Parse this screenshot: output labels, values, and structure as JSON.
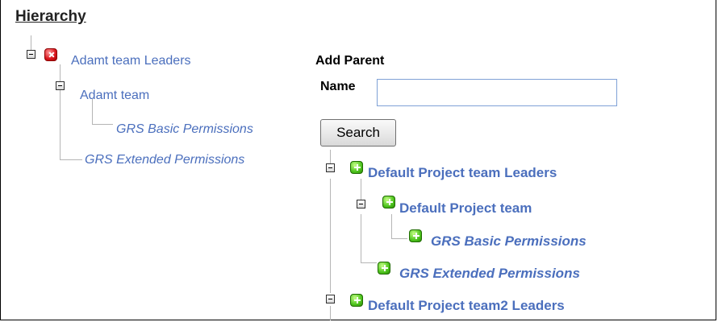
{
  "hierarchy": {
    "title": "Hierarchy",
    "nodes": [
      {
        "label": "Adamt team Leaders",
        "status": "remove"
      },
      {
        "label": "Adamt team"
      },
      {
        "label": "GRS Basic Permissions"
      },
      {
        "label": "GRS Extended Permissions"
      }
    ]
  },
  "add_parent": {
    "heading": "Add Parent",
    "name_label": "Name",
    "name_value": "",
    "name_placeholder": "",
    "search_label": "Search"
  },
  "results": [
    {
      "label": "Default Project team Leaders",
      "action": "add"
    },
    {
      "label": "Default Project team",
      "action": "add"
    },
    {
      "label": "GRS Basic Permissions",
      "action": "add"
    },
    {
      "label": "GRS Extended Permissions",
      "action": "add"
    },
    {
      "label": "Default Project team2 Leaders",
      "action": "add"
    }
  ],
  "colors": {
    "link": "#4b6fbd",
    "remove_icon": "#d8131b",
    "add_icon": "#4ec41e",
    "input_border": "#7fa1d6"
  }
}
